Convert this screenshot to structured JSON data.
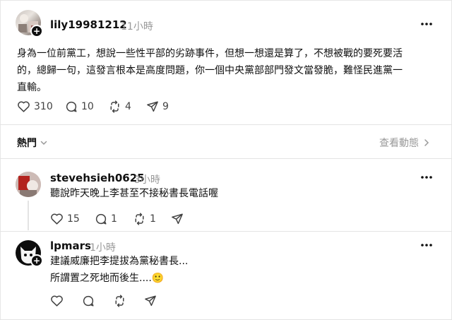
{
  "post": {
    "username": "lily19981212",
    "time": "11小時",
    "text_lines": [
      "身為一位前黨工，想說一些性平部的劣跡事件，但想一想還是算了，不想被戰的要死要活",
      "的，總歸一句，這發言根本是高度問題，你一個中央黨部部門發文當發脆，難怪民進黨一",
      "直輸。"
    ],
    "likes": "310",
    "replies": "10",
    "reposts": "4",
    "shares": "9"
  },
  "sort_bar": {
    "label": "熱門",
    "activity_label": "查看動態"
  },
  "replies": [
    {
      "username": "stevehsieh0625",
      "time": "3小時",
      "text_lines": [
        "聽說昨天晚上李甚至不接秘書長電話喔"
      ],
      "likes": "15",
      "replies": "1",
      "reposts": "1"
    },
    {
      "username": "lpmars",
      "time": "1小時",
      "text_lines": [
        "建議威廉把李提拔為黨秘書長...",
        "所謂置之死地而後生....🙂"
      ]
    }
  ],
  "colors": {
    "text": "#101010",
    "muted": "#999999",
    "divider": "#e4e4e4"
  }
}
